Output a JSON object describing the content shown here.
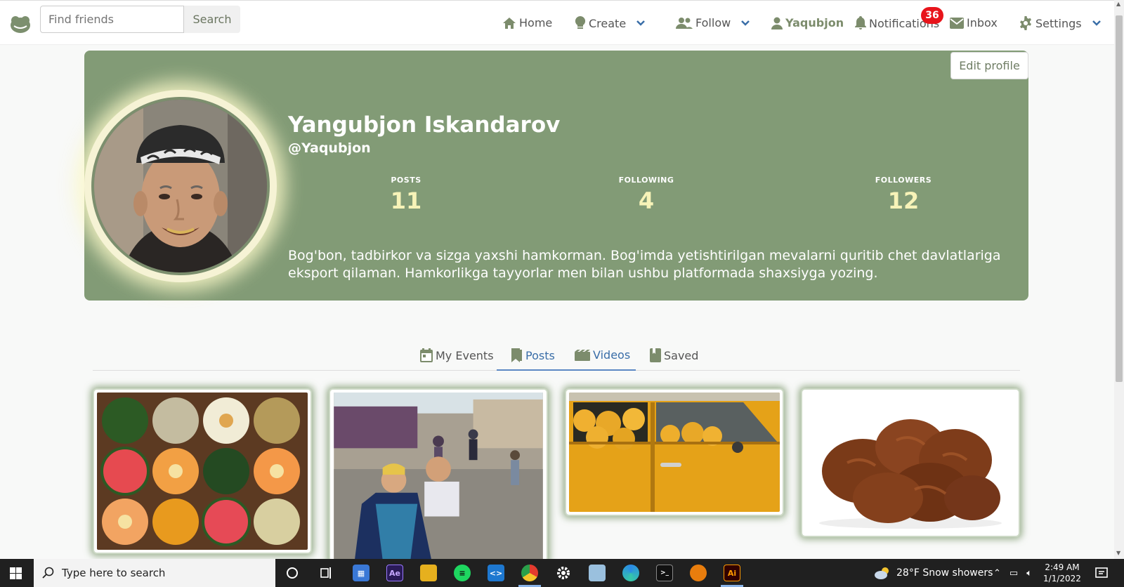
{
  "nav": {
    "search_placeholder": "Find friends",
    "search_button": "Search",
    "items": [
      {
        "label": "Home",
        "icon": "home-icon"
      },
      {
        "label": "Create",
        "icon": "lightbulb-icon",
        "dropdown": true
      },
      {
        "label": "Follow",
        "icon": "users-icon",
        "dropdown": true
      },
      {
        "label": "Yaqubjon",
        "icon": "user-icon"
      },
      {
        "label": "Notifications",
        "icon": "bell-icon"
      },
      {
        "label": "Inbox",
        "icon": "envelope-icon"
      },
      {
        "label": "Settings",
        "icon": "gear-icon",
        "dropdown": true
      }
    ],
    "notifications_count": "36"
  },
  "profile": {
    "name": "Yangubjon Iskandarov",
    "handle": "@Yaqubjon",
    "edit_label": "Edit profile",
    "stats": [
      {
        "label": "POSTS",
        "value": "11"
      },
      {
        "label": "FOLLOWING",
        "value": "4"
      },
      {
        "label": "FOLLOWERS",
        "value": "12"
      }
    ],
    "bio": "Bog'bon, tadbirkor va sizga yaxshi hamkorman. Bog'imda yetishtirilgan mevalarni quritib chet davlatlariga eksport qilaman. Hamkorlikga tayyorlar men bilan ushbu platformada shaxsiyga yozing."
  },
  "tabs": [
    {
      "label": "My Events",
      "icon": "calendar-icon"
    },
    {
      "label": "Posts",
      "icon": "bookmark-icon",
      "active": true
    },
    {
      "label": "Videos",
      "icon": "film-icon"
    },
    {
      "label": "Saved",
      "icon": "book-icon"
    }
  ],
  "posts": [
    {
      "subject": "melons and watermelons"
    },
    {
      "subject": "people dancing in market"
    },
    {
      "subject": "yellow car full of melons"
    },
    {
      "subject": "dried apricots"
    }
  ],
  "taskbar": {
    "search_placeholder": "Type here to search",
    "weather": "28°F  Snow showers",
    "time": "2:49 AM",
    "date": "1/1/2022"
  },
  "colors": {
    "brand": "#829b76",
    "accent_link": "#3a6ea8",
    "stat_number": "#f7f3b8",
    "badge": "#e8141b"
  }
}
